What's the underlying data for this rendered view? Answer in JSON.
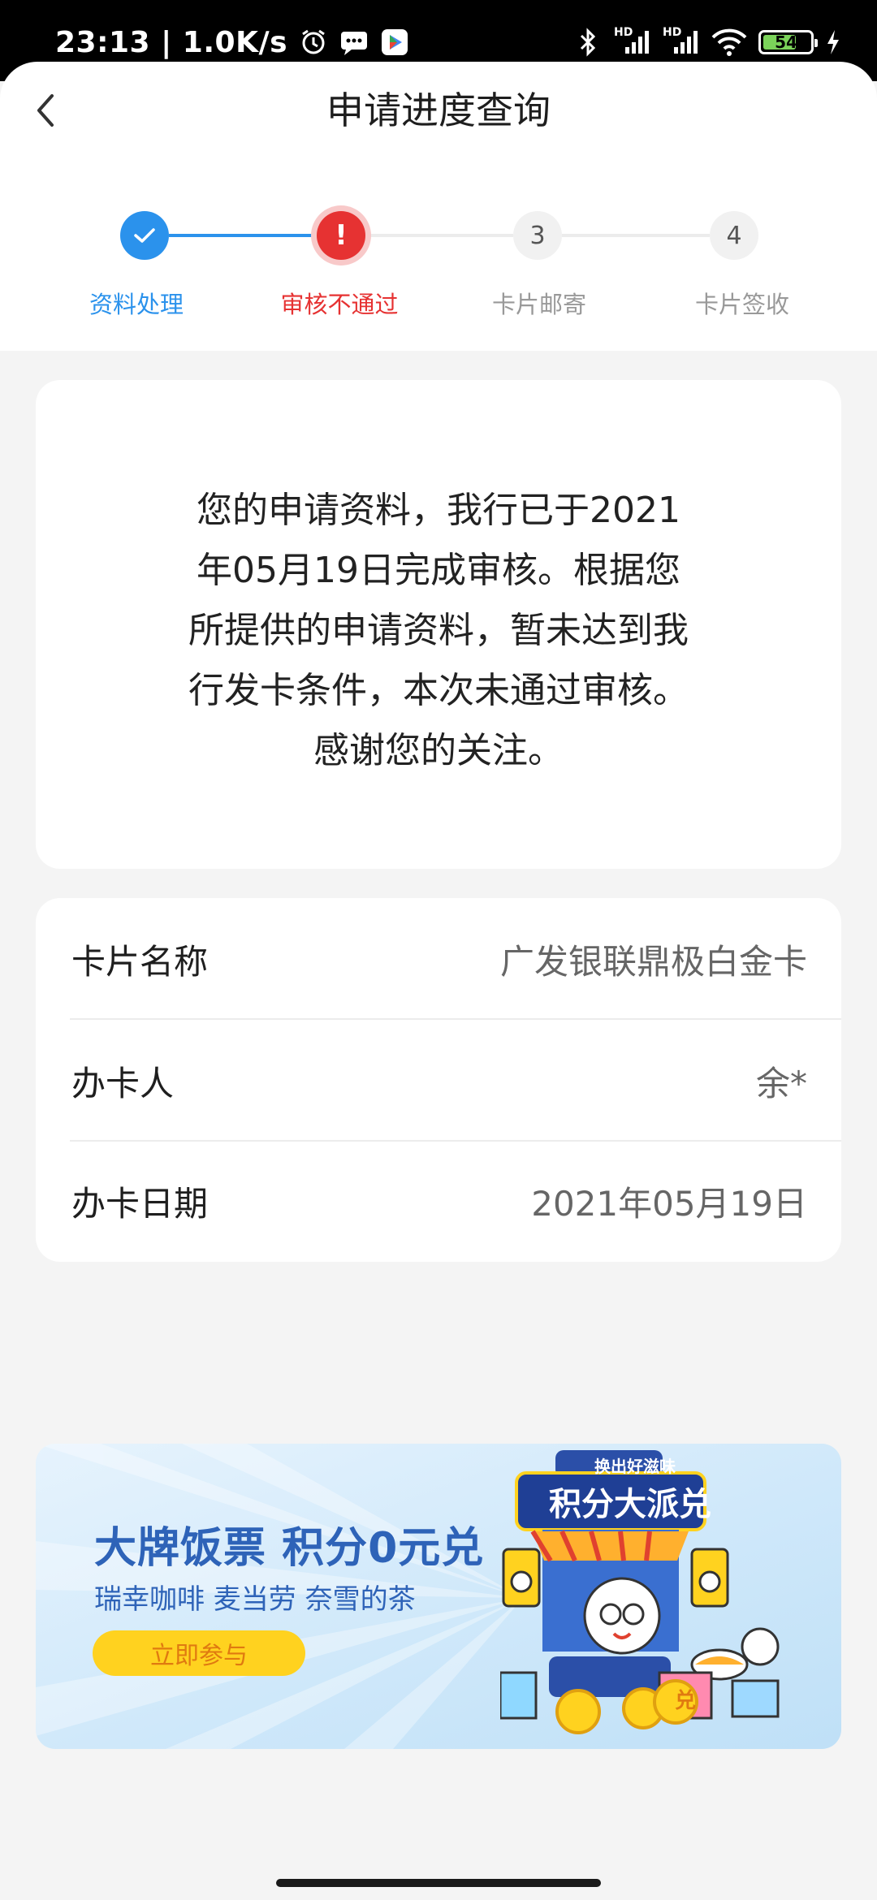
{
  "status_bar": {
    "time_speed": "23:13 | 1.0K/s",
    "network_1": "HD",
    "network_2": "HD",
    "battery": "54"
  },
  "header": {
    "title": "申请进度查询"
  },
  "steps": [
    {
      "label": "资料处理",
      "state": "done",
      "number": ""
    },
    {
      "label": "审核不通过",
      "state": "fail",
      "number": "!"
    },
    {
      "label": "卡片邮寄",
      "state": "todo",
      "number": "3"
    },
    {
      "label": "卡片签收",
      "state": "todo",
      "number": "4"
    }
  ],
  "message": "您的申请资料，我行已于2021年05月19日完成审核。根据您所提供的申请资料，暂未达到我行发卡条件，本次未通过审核。感谢您的关注。",
  "info": [
    {
      "key": "卡片名称",
      "value": "广发银联鼎极白金卡"
    },
    {
      "key": "办卡人",
      "value": "余*"
    },
    {
      "key": "办卡日期",
      "value": "2021年05月19日"
    }
  ],
  "banner": {
    "headline": "大牌饭票 积分0元兑",
    "sub": "瑞幸咖啡  麦当劳  奈雪的茶",
    "button": "立即参与",
    "art_tag": "换出好滋味",
    "art_title": "积分大派兑",
    "art_badge": "兑"
  },
  "colors": {
    "accent": "#2b92ec",
    "fail": "#e63232",
    "banner_text": "#2e63b8",
    "banner_button": "#ffd21f"
  }
}
